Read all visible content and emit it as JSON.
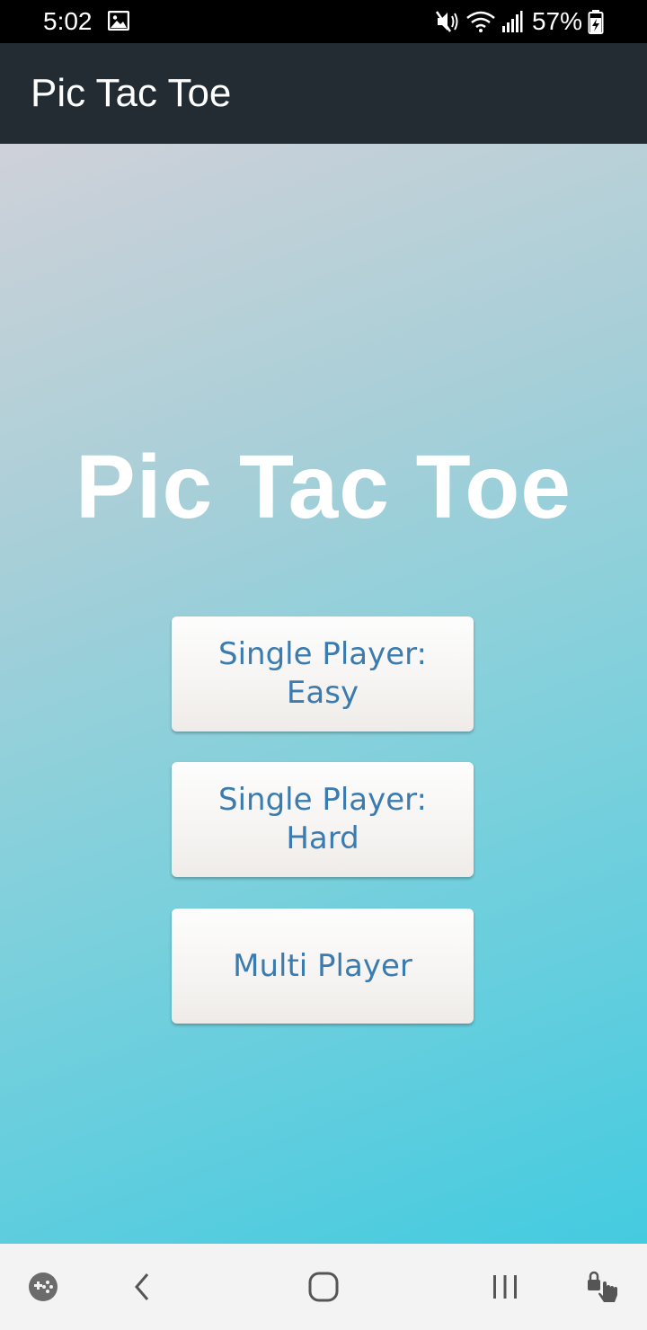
{
  "status_bar": {
    "time": "5:02",
    "battery": "57%",
    "icons": [
      "image-icon",
      "mute-icon",
      "wifi-icon",
      "signal-icon",
      "battery-charging-icon"
    ]
  },
  "app_bar": {
    "title": "Pic Tac Toe"
  },
  "main": {
    "game_title": "Pic Tac Toe",
    "buttons": [
      {
        "label": "Single Player:\nEasy"
      },
      {
        "label": "Single Player:\nHard"
      },
      {
        "label": "Multi Player"
      }
    ]
  },
  "nav_bar": {
    "icons": [
      "game-launcher-icon",
      "back-icon",
      "home-icon",
      "recents-icon",
      "touch-lock-icon"
    ]
  },
  "colors": {
    "app_bar": "#232c33",
    "button_text": "#3a7bb0",
    "gradient_top": "#cfd1d9",
    "gradient_bottom": "#44cbe0"
  }
}
